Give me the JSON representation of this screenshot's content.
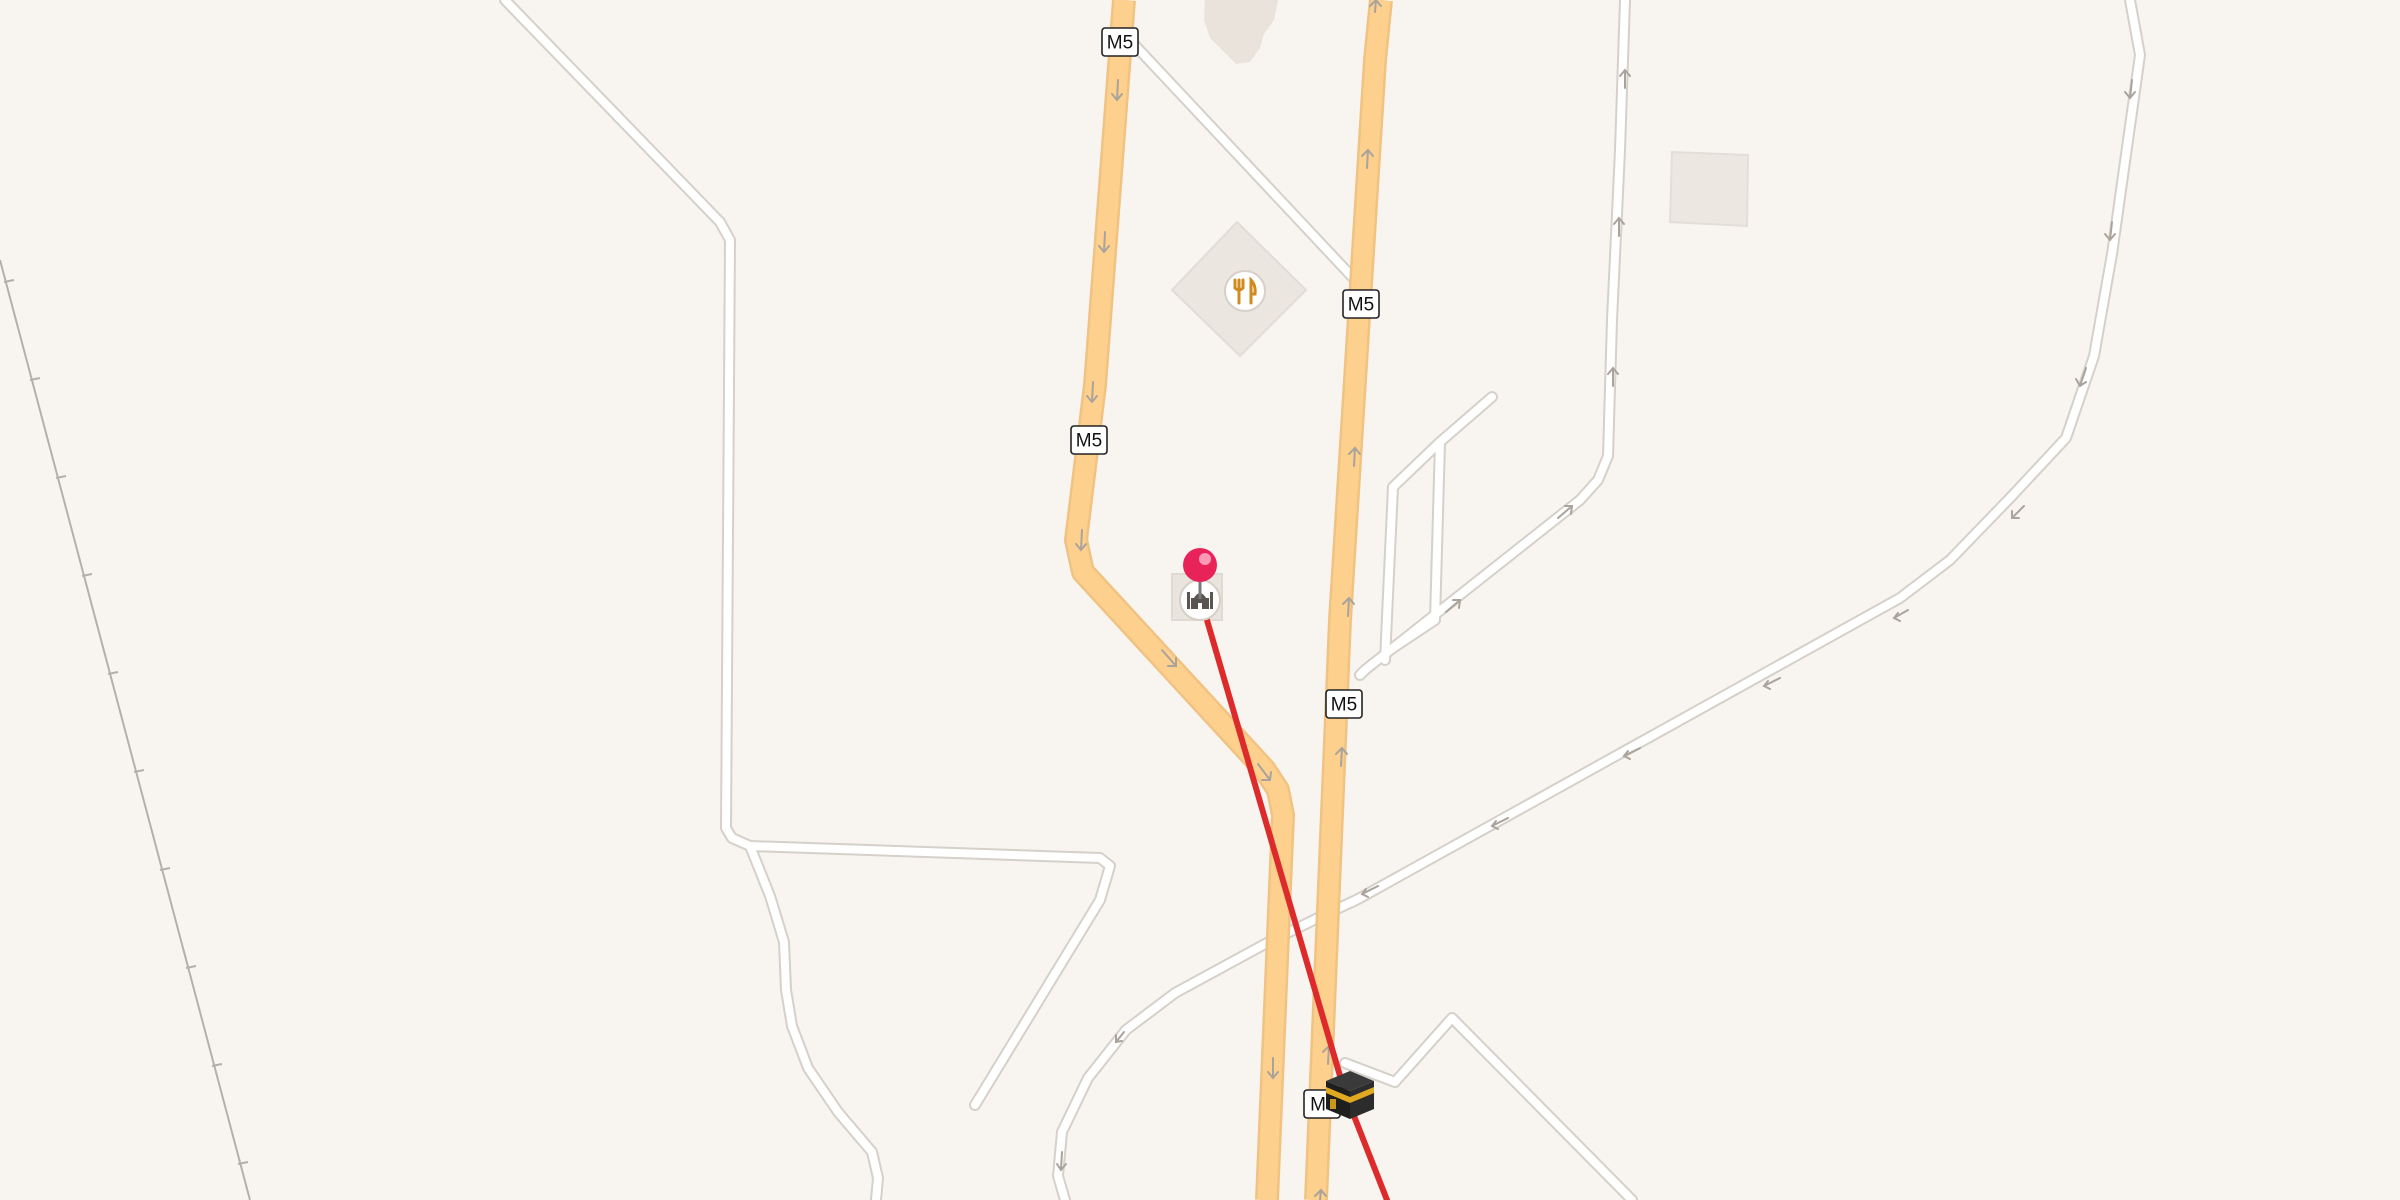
{
  "map": {
    "route_shields": [
      {
        "label": "M5"
      },
      {
        "label": "M5"
      },
      {
        "label": "M5"
      },
      {
        "label": "M5"
      },
      {
        "label": "M"
      }
    ],
    "markers": {
      "selected_pin": {
        "icon": "pin-icon",
        "color": "#e8235a"
      },
      "mosque_poi": {
        "icon": "mosque-icon"
      },
      "restaurant_poi": {
        "icon": "fork-knife-icon",
        "color": "#d18a1f"
      },
      "kaaba": {
        "icon": "kaaba-icon"
      }
    },
    "colors": {
      "background": "#f8f5f1",
      "motorway_fill": "#fdd08e",
      "motorway_casing": "#efc07f",
      "minor_road_fill": "#ffffff",
      "minor_road_casing": "#d6d2cc",
      "railway": "#aaaaaa",
      "building": "#ece7e1",
      "route_line": "#e12a2a"
    }
  }
}
